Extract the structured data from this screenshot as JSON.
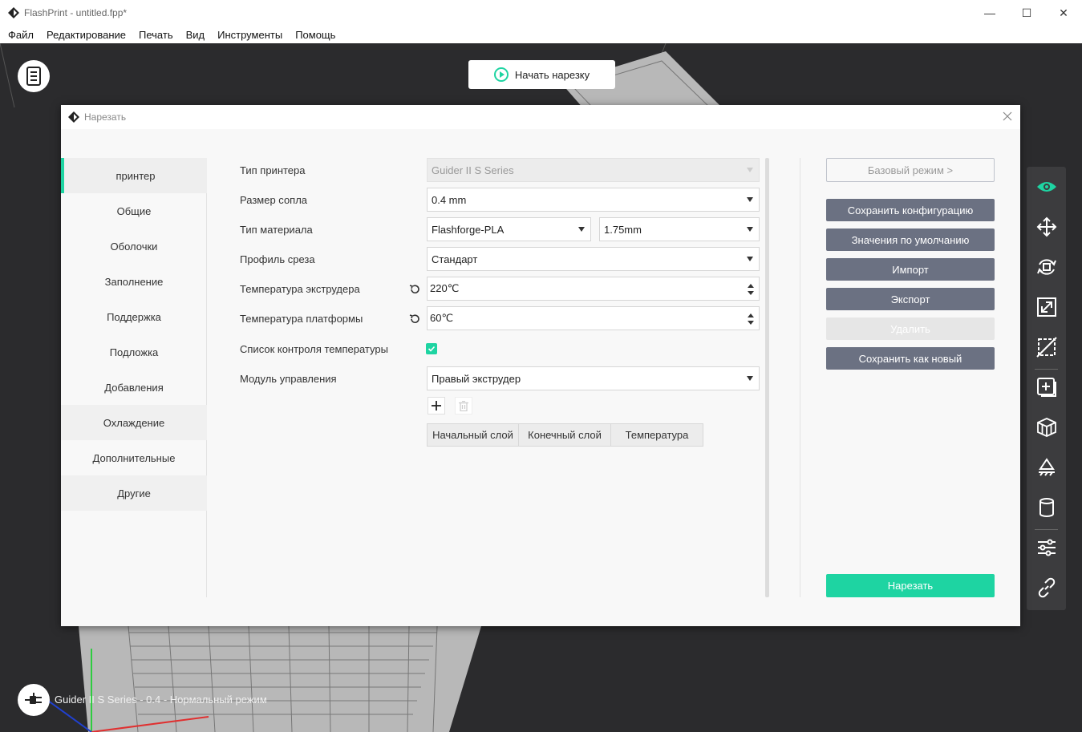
{
  "window": {
    "title": "FlashPrint - untitled.fpp*",
    "controls": {
      "minimize": "—",
      "maximize": "☐",
      "close": "✕"
    }
  },
  "menu": [
    "Файл",
    "Редактирование",
    "Печать",
    "Вид",
    "Инструменты",
    "Помощь"
  ],
  "viewport": {
    "start_slice_label": "Начать нарезку",
    "status_text": "Guider II S Series - 0.4 - Нормальный режим"
  },
  "dialog": {
    "title": "Нарезать",
    "sidebar": [
      "принтер",
      "Общие",
      "Оболочки",
      "Заполнение",
      "Поддержка",
      "Подложка",
      "Добавления",
      "Охлаждение",
      "Дополнительные",
      "Другие"
    ],
    "fields": {
      "printer_type": {
        "label": "Тип принтера",
        "value": "Guider II S Series"
      },
      "nozzle_size": {
        "label": "Размер сопла",
        "value": "0.4 mm"
      },
      "material_type": {
        "label": "Тип материала",
        "value": "Flashforge-PLA",
        "diameter": "1.75mm"
      },
      "slice_profile": {
        "label": "Профиль среза",
        "value": "Стандарт"
      },
      "extruder_temp": {
        "label": "Температура экструдера",
        "value": "220℃"
      },
      "platform_temp": {
        "label": "Температура платформы",
        "value": "60℃"
      },
      "temp_control_list": {
        "label": "Список контроля температуры",
        "checked": true
      },
      "control_module": {
        "label": "Модуль управления",
        "value": "Правый экструдер"
      }
    },
    "table_headers": [
      "Начальный слой",
      "Конечный слой",
      "Температура"
    ],
    "buttons": {
      "basic_mode": "Базовый режим  >",
      "save_config": "Сохранить конфигурацию",
      "defaults": "Значения по умолчанию",
      "import": "Импорт",
      "export": "Экспорт",
      "delete": "Удалить",
      "save_new": "Сохранить как новый",
      "slice": "Нарезать"
    }
  },
  "colors": {
    "accent": "#1ed4a2",
    "button_gray": "#6b7182",
    "viewport_bg": "#2b2b2d",
    "toolbar_bg": "#3c3c3e"
  },
  "toolbar_icons": [
    "eye-icon",
    "move-icon",
    "rotate-icon",
    "scale-icon",
    "cut-icon",
    "add-support-icon",
    "multi-cube-icon",
    "lay-flat-icon",
    "cylinder-icon",
    "sliders-icon",
    "link-icon"
  ]
}
